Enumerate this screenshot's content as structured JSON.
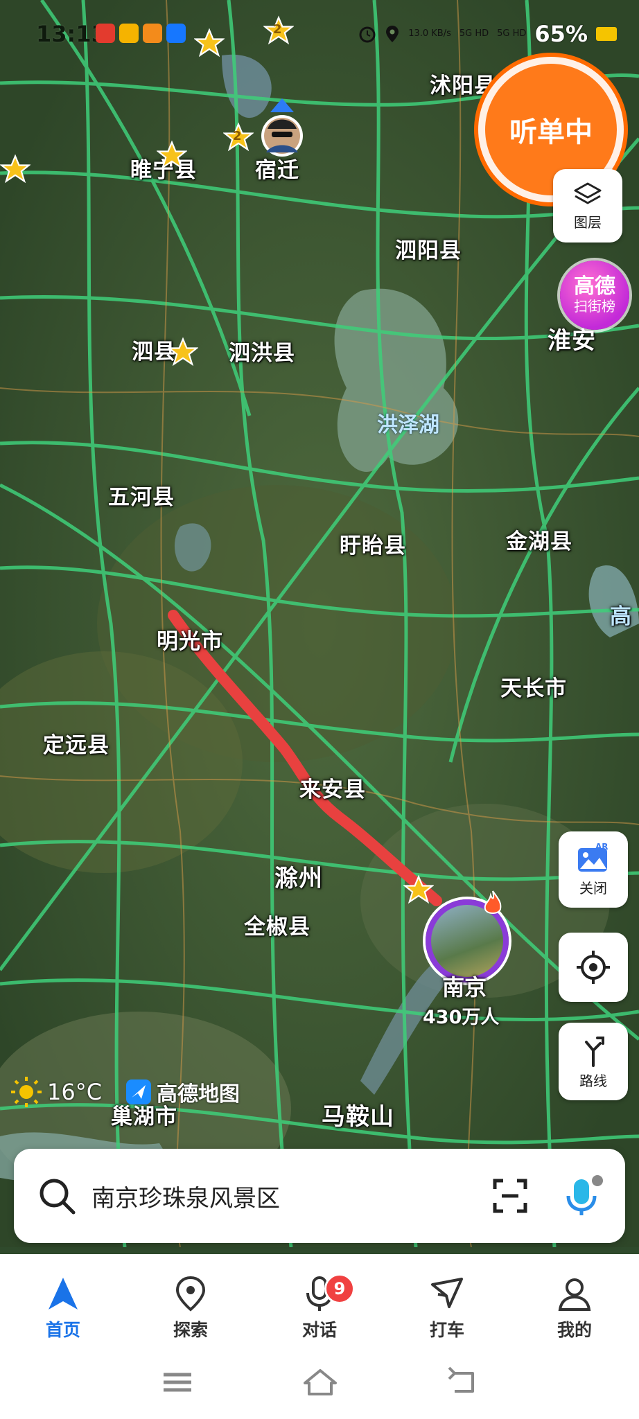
{
  "status": {
    "time": "13:13",
    "battery": "65%",
    "net_speed": "13.0 KB/s",
    "signal1": "5G HD",
    "signal2": "5G HD"
  },
  "map": {
    "labels": {
      "shuyang": "沭阳县",
      "suining": "睢宁县",
      "suqian": "宿迁",
      "siyang": "泗阳县",
      "sixian": "泗县",
      "sihong": "泗洪县",
      "huaian": "淮安",
      "hongze": "洪泽湖",
      "wuhe": "五河县",
      "xuyi": "盱眙县",
      "jinhu": "金湖县",
      "mingguang": "明光市",
      "tianchang": "天长市",
      "dingyuan": "定远县",
      "laian": "来安县",
      "chuzhou": "滁州",
      "quanjiao": "全椒县",
      "chaohu": "巢湖市",
      "maanshan": "马鞍山",
      "gao": "高"
    },
    "stars": [
      "2",
      "2"
    ],
    "nanjing": {
      "name": "南京",
      "population": "430万人"
    },
    "route_color": "#e8413f"
  },
  "listening": {
    "label": "听单中"
  },
  "side": {
    "layers_label": "图层",
    "ar_label": "关闭",
    "route_label": "路线"
  },
  "rank": {
    "line1": "高德",
    "line2": "扫街榜"
  },
  "weather": {
    "temp": "16°C"
  },
  "brand": {
    "name": "高德地图"
  },
  "search": {
    "query": "南京珍珠泉风景区"
  },
  "tabs": [
    {
      "label": "首页",
      "icon": "navigation-arrow-icon",
      "active": true
    },
    {
      "label": "探索",
      "icon": "location-pin-icon",
      "active": false
    },
    {
      "label": "对话",
      "icon": "microphone-icon",
      "active": false,
      "badge": "9"
    },
    {
      "label": "打车",
      "icon": "taxi-icon",
      "active": false
    },
    {
      "label": "我的",
      "icon": "profile-icon",
      "active": false
    }
  ]
}
